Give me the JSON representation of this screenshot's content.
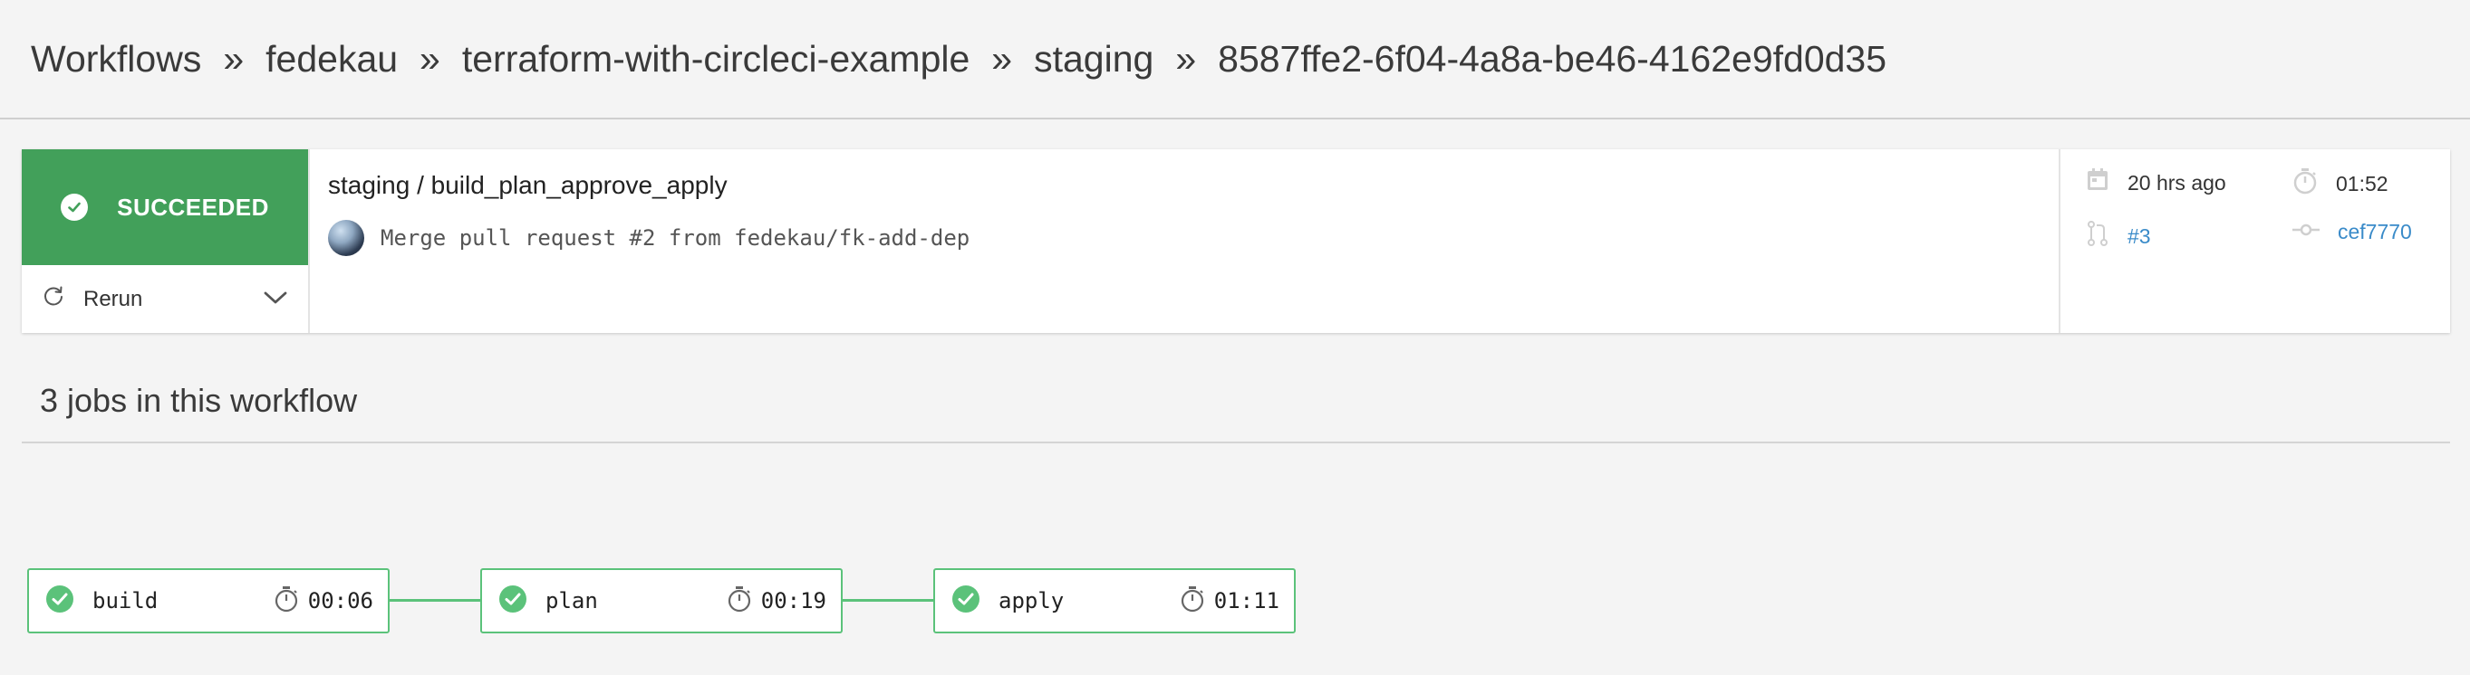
{
  "breadcrumb": {
    "items": [
      "Workflows",
      "fedekau",
      "terraform-with-circleci-example",
      "staging",
      "8587ffe2-6f04-4a8a-be46-4162e9fd0d35"
    ],
    "separator": "»"
  },
  "summary": {
    "status": "SUCCEEDED",
    "status_color": "#42a05a",
    "rerun_label": "Rerun",
    "workflow_name": "staging / build_plan_approve_apply",
    "commit_message": "Merge pull request #2 from fedekau/fk-add-dep",
    "time_ago": "20 hrs ago",
    "duration": "01:52",
    "pull_request": "#3",
    "commit_hash": "cef7770",
    "link_color": "#3a8bc9"
  },
  "jobs": {
    "heading": "3 jobs in this workflow",
    "items": [
      {
        "name": "build",
        "duration": "00:06",
        "status": "success"
      },
      {
        "name": "plan",
        "duration": "00:19",
        "status": "success"
      },
      {
        "name": "apply",
        "duration": "01:11",
        "status": "success"
      }
    ],
    "success_color": "#5bc27a"
  }
}
